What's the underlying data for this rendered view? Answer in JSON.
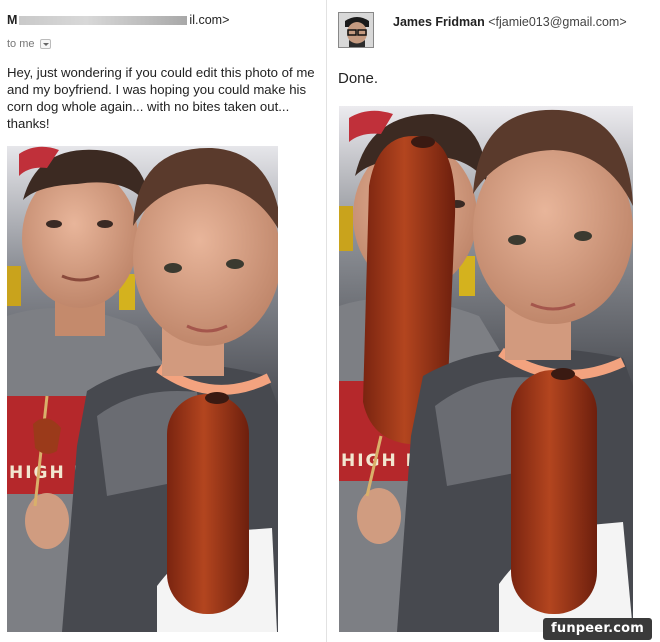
{
  "left_email": {
    "sender_prefix": "M",
    "sender_suffix": "il.com>",
    "to_label": "to me",
    "message": "Hey, just wondering if you could edit this photo of me and my boyfriend. I was hoping you could make his corn dog whole again... with no bites taken out... thanks!",
    "shirt_text": "HIGH L"
  },
  "reply": {
    "sender_name": "James Fridman",
    "sender_email": "<fjamie013@gmail.com>",
    "message": "Done.",
    "shirt_text": "HIGH L"
  },
  "watermark": "funpeer.com",
  "colors": {
    "background": "#ffffff",
    "text": "#222222",
    "corndog": "#a83a1a",
    "shirt_red": "#b5282b",
    "shirt_grey": "#7d7f84",
    "watermark_bg": "#3a3a3a"
  }
}
